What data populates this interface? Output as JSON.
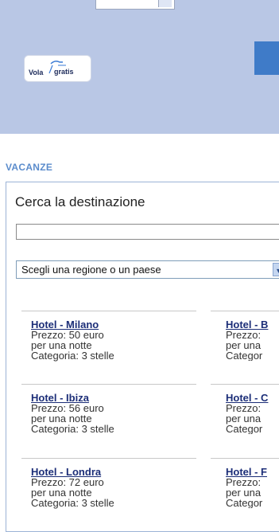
{
  "header": {
    "logo_text_left": "Vola",
    "logo_text_right": "gratis"
  },
  "section_title": "VACANZE",
  "search": {
    "label": "Cerca la destinazione",
    "value": "",
    "placeholder": ""
  },
  "region_select": {
    "selected": "Scegli una regione o un paese"
  },
  "hotels": [
    {
      "name": "Hotel - Milano",
      "price": "Prezzo: 50 euro",
      "per": "per una notte",
      "category": "Categoria: 3 stelle"
    },
    {
      "name": "Hotel - B",
      "price": "Prezzo:",
      "per": "per una",
      "category": "Categor"
    },
    {
      "name": "Hotel - Ibiza",
      "price": "Prezzo: 56 euro",
      "per": "per una notte",
      "category": "Categoria: 3 stelle"
    },
    {
      "name": "Hotel - C",
      "price": "Prezzo:",
      "per": "per una",
      "category": "Categor"
    },
    {
      "name": "Hotel - Londra",
      "price": "Prezzo: 72 euro",
      "per": "per una notte",
      "category": "Categoria: 3 stelle"
    },
    {
      "name": "Hotel - F",
      "price": "Prezzo:",
      "per": "per una",
      "category": "Categor"
    }
  ]
}
